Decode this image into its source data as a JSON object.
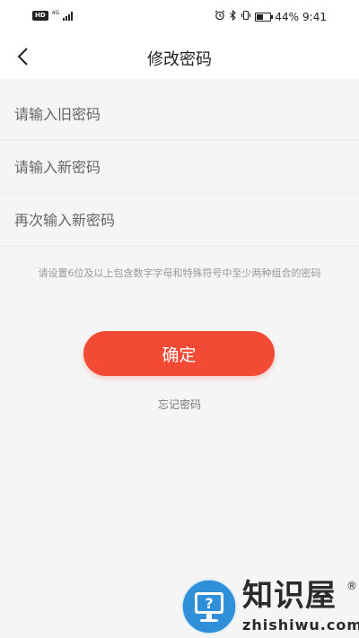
{
  "status_bar": {
    "hd_label": "HD",
    "network_type": "4G",
    "battery_percent": "44%",
    "battery_level": 0.44,
    "time": "9:41",
    "icons": [
      "alarm-icon",
      "bluetooth-icon",
      "vibrate-icon",
      "battery-icon"
    ]
  },
  "header": {
    "title": "修改密码",
    "back_icon": "chevron-left-icon"
  },
  "form": {
    "old_password": {
      "value": "",
      "placeholder": "请输入旧密码"
    },
    "new_password": {
      "value": "",
      "placeholder": "请输入新密码"
    },
    "confirm_password": {
      "value": "",
      "placeholder": "再次输入新密码"
    }
  },
  "hint": "请设置6位及以上包含数字字母和特殊符号中至少两种组合的密码",
  "actions": {
    "confirm_label": "确定",
    "forgot_label": "忘记密码"
  },
  "watermark": {
    "name": "知识屋",
    "reg_mark": "®",
    "domain": "zhishiwu.com"
  },
  "colors": {
    "accent": "#f24a34",
    "background": "#f5f5f5",
    "watermark_blue": "#2f8fd8"
  }
}
